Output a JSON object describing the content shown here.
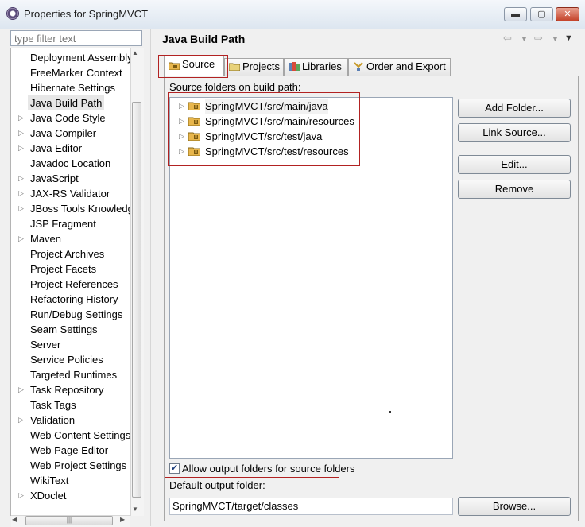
{
  "window": {
    "title": "Properties for SpringMVCT",
    "buttons": {
      "minimize": "▬",
      "maximize": "▢",
      "close": "✕"
    }
  },
  "filter": {
    "placeholder": "type filter text"
  },
  "tree": {
    "items": [
      {
        "label": "Deployment Assembly",
        "expandable": false
      },
      {
        "label": "FreeMarker Context",
        "expandable": false
      },
      {
        "label": "Hibernate Settings",
        "expandable": false
      },
      {
        "label": "Java Build Path",
        "expandable": false,
        "selected": true
      },
      {
        "label": "Java Code Style",
        "expandable": true
      },
      {
        "label": "Java Compiler",
        "expandable": true
      },
      {
        "label": "Java Editor",
        "expandable": true
      },
      {
        "label": "Javadoc Location",
        "expandable": false
      },
      {
        "label": "JavaScript",
        "expandable": true
      },
      {
        "label": "JAX-RS Validator",
        "expandable": true
      },
      {
        "label": "JBoss Tools Knowledg",
        "expandable": true
      },
      {
        "label": "JSP Fragment",
        "expandable": false
      },
      {
        "label": "Maven",
        "expandable": true
      },
      {
        "label": "Project Archives",
        "expandable": false
      },
      {
        "label": "Project Facets",
        "expandable": false
      },
      {
        "label": "Project References",
        "expandable": false
      },
      {
        "label": "Refactoring History",
        "expandable": false
      },
      {
        "label": "Run/Debug Settings",
        "expandable": false
      },
      {
        "label": "Seam Settings",
        "expandable": false
      },
      {
        "label": "Server",
        "expandable": false
      },
      {
        "label": "Service Policies",
        "expandable": false
      },
      {
        "label": "Targeted Runtimes",
        "expandable": false
      },
      {
        "label": "Task Repository",
        "expandable": true
      },
      {
        "label": "Task Tags",
        "expandable": false
      },
      {
        "label": "Validation",
        "expandable": true
      },
      {
        "label": "Web Content Settings",
        "expandable": false
      },
      {
        "label": "Web Page Editor",
        "expandable": false
      },
      {
        "label": "Web Project Settings",
        "expandable": false
      },
      {
        "label": "WikiText",
        "expandable": false
      },
      {
        "label": "XDoclet",
        "expandable": true
      }
    ]
  },
  "header": {
    "title": "Java Build Path"
  },
  "tabs": [
    {
      "label": "Source",
      "active": true
    },
    {
      "label": "Projects",
      "active": false
    },
    {
      "label": "Libraries",
      "active": false
    },
    {
      "label": "Order and Export",
      "active": false
    }
  ],
  "source": {
    "list_label": "Source folders on build path:",
    "folders": [
      "SpringMVCT/src/main/java",
      "SpringMVCT/src/main/resources",
      "SpringMVCT/src/test/java",
      "SpringMVCT/src/test/resources"
    ],
    "buttons": {
      "add_folder": "Add Folder...",
      "link_source": "Link Source...",
      "edit": "Edit...",
      "remove": "Remove",
      "browse": "Browse..."
    },
    "allow_output_label": "Allow output folders for source folders",
    "allow_output_checked": true,
    "default_output_label": "Default output folder:",
    "default_output_value": "SpringMVCT/target/classes"
  },
  "colors": {
    "highlight": "#b22222",
    "folder": "#e8b64c"
  }
}
